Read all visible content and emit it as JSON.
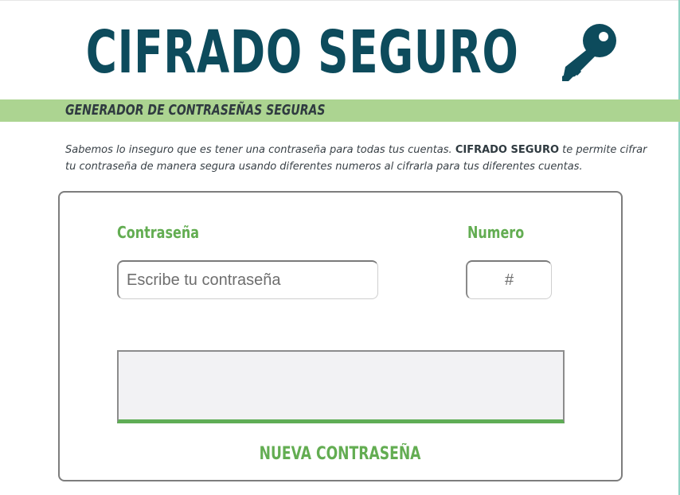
{
  "header": {
    "title": "CIFRADO SEGURO",
    "icon": "key-icon",
    "icon_color": "#0d4b5c"
  },
  "subtitle": "GENERADOR DE CONTRASEÑAS SEGURAS",
  "intro": {
    "before": "Sabemos lo inseguro que es tener una contraseña para todas tus cuentas. ",
    "brand": "CIFRADO SEGURO",
    "after": " te permite cifrar tu contraseña de manera segura usando diferentes numeros al cifrarla para tus diferentes cuentas."
  },
  "form": {
    "password_label": "Contraseña",
    "password_placeholder": "Escribe tu contraseña",
    "password_value": "",
    "number_label": "Numero",
    "number_placeholder": "#",
    "number_value": "",
    "output_value": "",
    "new_password_button": "NUEVA CONTRASEÑA"
  },
  "colors": {
    "title": "#0d4b5c",
    "accent_green": "#63ad52",
    "band_green": "#acd491",
    "output_bg": "#f2f2f4"
  }
}
